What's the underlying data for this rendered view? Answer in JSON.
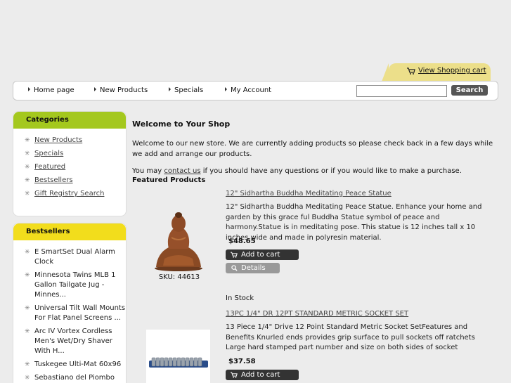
{
  "cart": {
    "link": "View Shopping cart",
    "icon": "cart-icon"
  },
  "nav": {
    "items": [
      {
        "label": "Home page"
      },
      {
        "label": "New Products"
      },
      {
        "label": "Specials"
      },
      {
        "label": "My Account"
      }
    ],
    "search_button": "Search",
    "search_value": ""
  },
  "categories": {
    "title": "Categories",
    "items": [
      "New Products",
      "Specials",
      "Featured",
      "Bestsellers",
      "Gift Registry Search"
    ]
  },
  "bestsellers": {
    "title": "Bestsellers",
    "items": [
      "E SmartSet Dual Alarm Clock",
      "Minnesota Twins MLB 1 Gallon Tailgate Jug - Minnes...",
      "Universal Tilt Wall Mounts For Flat Panel Screens ...",
      "Arc IV Vortex Cordless Men's Wet/Dry Shaver With H...",
      "Tuskegee Ulti-Mat 60x96",
      "Sebastiano del Piombo"
    ]
  },
  "main": {
    "title": "Welcome to Your Shop",
    "welcome_text": "Welcome to our new store. We are currently adding products so please check back in a few days while we add and arrange our products.",
    "contact_prefix": "You may ",
    "contact_link": "contact us",
    "contact_suffix": " if you should have any questions or if you would like to make a purchase.",
    "featured_heading": "Featured Products"
  },
  "products": [
    {
      "name": "12\" Sidhartha Buddha Meditating Peace Statue",
      "description": "12\" Sidhartha Buddha Meditating Peace Statue. Enhance your home and garden by this grace ful Buddha Statue symbol of peace and harmony.Statue is in meditating pose. This statue is 12 inches tall x 10 inches wide and made in polyresin material.",
      "price": "$48.65",
      "sku": "SKU: 44613",
      "add_label": "Add to cart",
      "details_label": "Details",
      "stock": "In Stock"
    },
    {
      "name": "13PC 1/4\" DR 12PT STANDARD METRIC SOCKET SET",
      "description": "13 Piece 1/4\" Drive 12 Point Standard Metric Socket SetFeatures and Benefits Knurled ends provides grip surface to pull sockets off ratchets Large hard stamped part number and size on both sides of socket",
      "price": "$37.58",
      "add_label": "Add to cart"
    }
  ]
}
